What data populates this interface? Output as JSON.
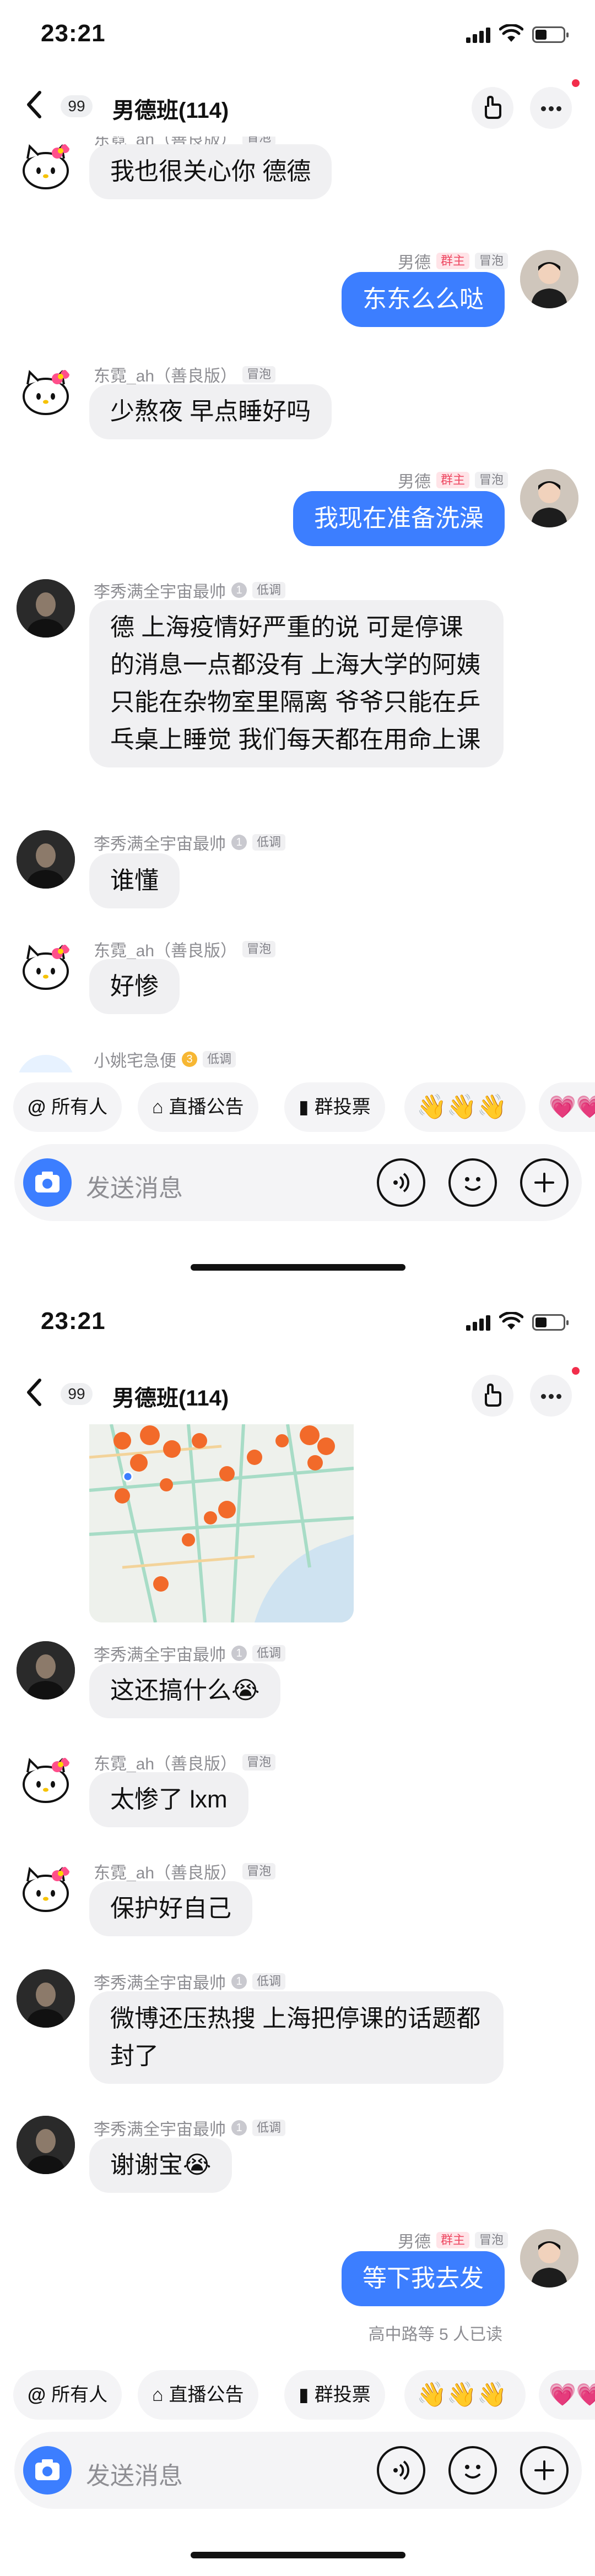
{
  "status_bar": {
    "time": "23:21"
  },
  "nav": {
    "unread_count": "99",
    "group_title": "男德班(114)"
  },
  "senders": {
    "dongni": "东霓_ah（善良版）",
    "lixiu": "李秀满全宇宙最帅",
    "me": "男德",
    "xiaoyao": "小姚宅急便"
  },
  "tags": {
    "bubble": "冒泡",
    "lowkey": "低调",
    "owner": "群主"
  },
  "levels": {
    "lixiu": "1",
    "xiaoyao": "3"
  },
  "screen1": {
    "messages": [
      {
        "text": "我也很关心你 德德"
      },
      {
        "text": "东东么么哒"
      },
      {
        "text": "少熬夜 早点睡好吗"
      },
      {
        "text": "我现在准备洗澡"
      },
      {
        "text": "德 上海疫情好严重的说 可是停课的消息一点都没有 上海大学的阿姨只能在杂物室里隔离 爷爷只能在乒乓桌上睡觉 我们每天都在用命上课"
      },
      {
        "text": "谁懂"
      },
      {
        "text": "好惨"
      }
    ]
  },
  "screen2": {
    "messages": [
      {
        "text": "这还搞什么😭"
      },
      {
        "text": "太惨了 lxm"
      },
      {
        "text": "保护好自己"
      },
      {
        "text": "微博还压热搜 上海把停课的话题都封了"
      },
      {
        "text": "谢谢宝😭"
      },
      {
        "text": "等下我去发"
      }
    ],
    "read_receipt": "高中路等 5 人已读"
  },
  "toolbar": {
    "mention_all": "所有人",
    "live_notice": "直播公告",
    "group_vote": "群投票",
    "emoji_reactions": "👋👋👋",
    "heart_reactions": "💗💗"
  },
  "input": {
    "placeholder": "发送消息"
  },
  "icons": [
    "back-arrow-icon",
    "pointing-hand-icon",
    "more-icon",
    "camera-icon",
    "voice-icon",
    "emoji-face-icon",
    "plus-icon",
    "at-icon",
    "announcement-icon",
    "chart-icon"
  ],
  "colors": {
    "accent_blue": "#3c7eff",
    "owner_red": "#ee4a63",
    "map_marker": "#f26a2a"
  }
}
